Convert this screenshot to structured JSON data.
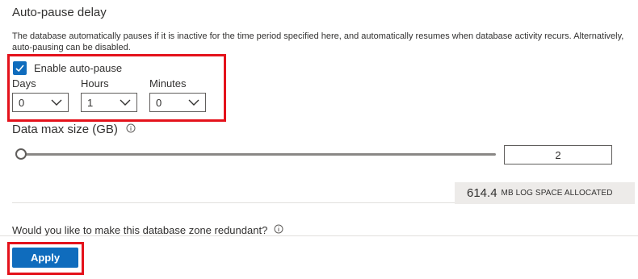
{
  "autopause": {
    "title": "Auto-pause delay",
    "description": "The database automatically pauses if it is inactive for the time period specified here, and automatically resumes when database activity recurs. Alternatively, auto-pausing can be disabled.",
    "enable_label": "Enable auto-pause",
    "enable_checked": true,
    "days": {
      "label": "Days",
      "value": "0"
    },
    "hours": {
      "label": "Hours",
      "value": "1"
    },
    "minutes": {
      "label": "Minutes",
      "value": "0"
    }
  },
  "data_max_size": {
    "label": "Data max size (GB)",
    "value": "2",
    "slider_fraction": 0
  },
  "log_space": {
    "value": "614.4",
    "label": "MB LOG SPACE ALLOCATED"
  },
  "zone_redundant": {
    "question": "Would you like to make this database zone redundant?"
  },
  "apply_label": "Apply",
  "colors": {
    "accent": "#0f6cbd",
    "highlight_red": "#e4121b"
  },
  "icons": [
    "checkmark-icon",
    "chevron-down-icon",
    "info-icon"
  ]
}
